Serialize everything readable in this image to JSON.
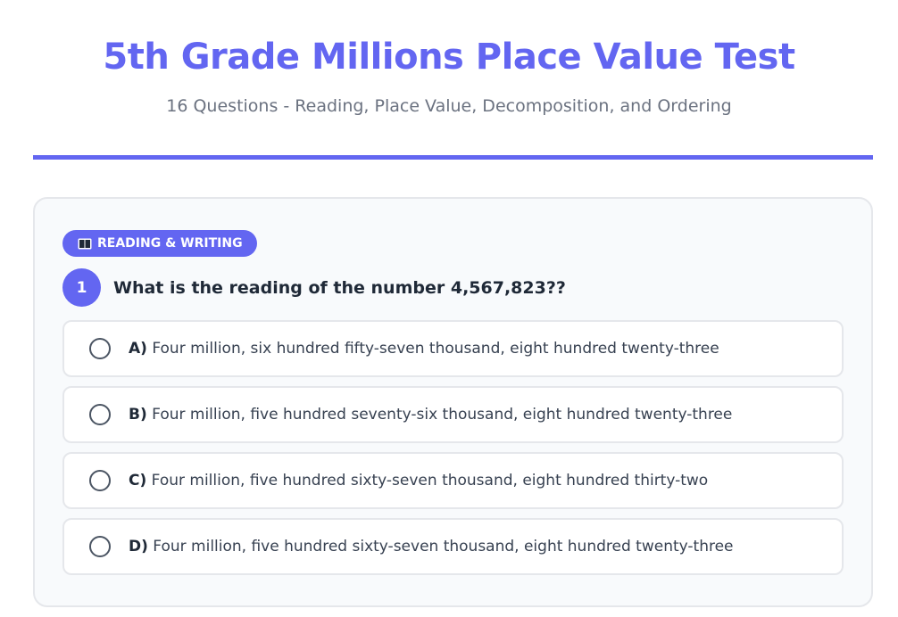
{
  "header": {
    "title": "5th Grade Millions Place Value Test",
    "subtitle": "16 Questions - Reading, Place Value, Decomposition, and Ordering"
  },
  "question": {
    "category_icon": "book-icon",
    "category": "READING & WRITING",
    "number": "1",
    "text": "What is the reading of the number 4,567,823??",
    "options": [
      {
        "letter": "A)",
        "text": "Four million, six hundred fifty-seven thousand, eight hundred twenty-three"
      },
      {
        "letter": "B)",
        "text": "Four million, five hundred seventy-six thousand, eight hundred twenty-three"
      },
      {
        "letter": "C)",
        "text": "Four million, five hundred sixty-seven thousand, eight hundred thirty-two"
      },
      {
        "letter": "D)",
        "text": "Four million, five hundred sixty-seven thousand, eight hundred twenty-three"
      }
    ]
  },
  "colors": {
    "accent": "#6366f1",
    "card_background": "#f8fafc",
    "border": "#e5e7eb"
  }
}
